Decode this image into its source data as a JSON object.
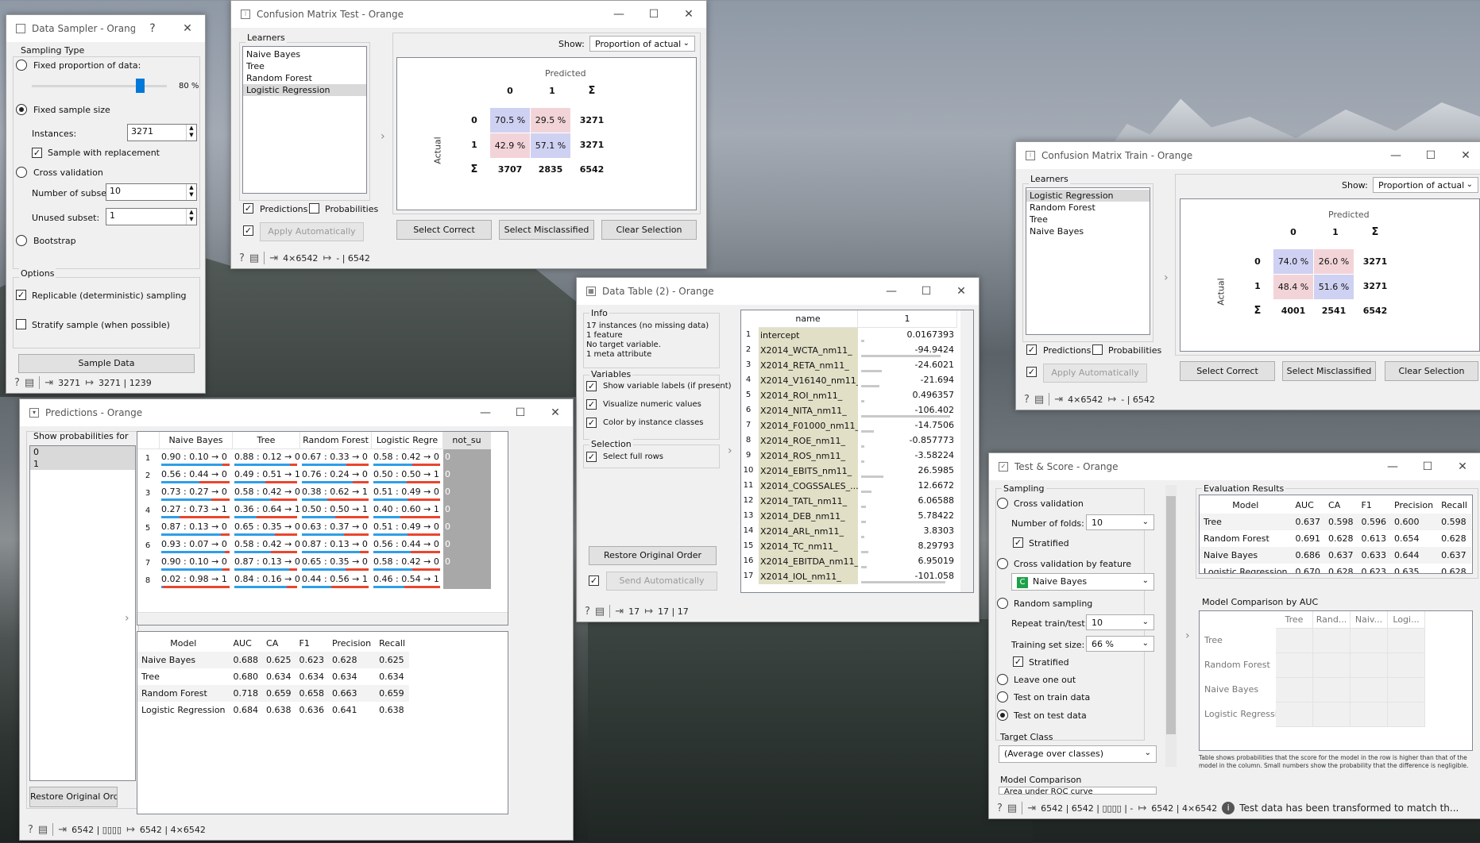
{
  "data_sampler": {
    "title": "Data Sampler - Orange",
    "help": "?",
    "sampling_type": "Sampling Type",
    "fixed_proportion": "Fixed proportion of data:",
    "percent": "80 %",
    "fixed_size": "Fixed sample size",
    "instances_label": "Instances:",
    "instances": "3271",
    "replacement": "Sample with replacement",
    "cross_validation": "Cross validation",
    "subsets_label": "Number of subsets:",
    "subsets": "10",
    "unused_label": "Unused subset:",
    "unused": "1",
    "bootstrap": "Bootstrap",
    "options": "Options",
    "replicable": "Replicable (deterministic) sampling",
    "stratify": "Stratify sample (when possible)",
    "sample_btn": "Sample Data",
    "in": "3271",
    "out": "3271 | 1239",
    "slider_value": 0.8
  },
  "cm_test": {
    "title": "Confusion Matrix Test - Orange",
    "learners_label": "Learners",
    "learners": [
      "Naive Bayes",
      "Tree",
      "Random Forest",
      "Logistic Regression"
    ],
    "show": "Show:",
    "show_value": "Proportion of actual",
    "predicted": "Predicted",
    "actual": "Actual",
    "c0": "0",
    "c1": "1",
    "sum": "Σ",
    "r0c0": "70.5 %",
    "r0c1": "29.5 %",
    "r0s": "3271",
    "r1c0": "42.9 %",
    "r1c1": "57.1 %",
    "r1s": "3271",
    "s0": "3707",
    "s1": "2835",
    "st": "6542",
    "predictions": "Predictions",
    "probabilities": "Probabilities",
    "apply": "Apply Automatically",
    "sel_correct": "Select Correct",
    "sel_mis": "Select Misclassified",
    "clear": "Clear Selection",
    "in": "4×6542",
    "out": "- | 6542"
  },
  "cm_train": {
    "title": "Confusion Matrix Train - Orange",
    "learners_label": "Learners",
    "learners": [
      "Logistic Regression",
      "Random Forest",
      "Tree",
      "Naive Bayes"
    ],
    "show": "Show:",
    "show_value": "Proportion of actual",
    "predicted": "Predicted",
    "actual": "Actual",
    "c0": "0",
    "c1": "1",
    "sum": "Σ",
    "r0c0": "74.0 %",
    "r0c1": "26.0 %",
    "r0s": "3271",
    "r1c0": "48.4 %",
    "r1c1": "51.6 %",
    "r1s": "3271",
    "s0": "4001",
    "s1": "2541",
    "st": "6542",
    "predictions": "Predictions",
    "probabilities": "Probabilities",
    "apply": "Apply Automatically",
    "sel_correct": "Select Correct",
    "sel_mis": "Select Misclassified",
    "clear": "Clear Selection",
    "in": "4×6542",
    "out": "- | 6542"
  },
  "data_table": {
    "title": "Data Table (2) - Orange",
    "info": "Info",
    "info_lines": [
      "17 instances (no missing data)",
      "1 feature",
      "No target variable.",
      "1 meta attribute"
    ],
    "variables": "Variables",
    "show_labels": "Show variable labels (if present)",
    "visualize": "Visualize numeric values",
    "color": "Color by instance classes",
    "selection": "Selection",
    "select_full": "Select full rows",
    "restore": "Restore Original Order",
    "send": "Send Automatically",
    "col_name": "name",
    "col_val": "1",
    "rows": [
      {
        "n": "1",
        "name": "intercept",
        "v": "0.0167393"
      },
      {
        "n": "2",
        "name": "X2014_WCTA_nm11_",
        "v": "-94.9424"
      },
      {
        "n": "3",
        "name": "X2014_RETA_nm11_",
        "v": "-24.6021"
      },
      {
        "n": "4",
        "name": "X2014_V16140_nm11_",
        "v": "-21.694"
      },
      {
        "n": "5",
        "name": "X2014_ROI_nm11_",
        "v": "0.496357"
      },
      {
        "n": "6",
        "name": "X2014_NITA_nm11_",
        "v": "-106.402"
      },
      {
        "n": "7",
        "name": "X2014_F01000_nm11_",
        "v": "-14.7506"
      },
      {
        "n": "8",
        "name": "X2014_ROE_nm11_",
        "v": "-0.857773"
      },
      {
        "n": "9",
        "name": "X2014_ROS_nm11_",
        "v": "-3.58224"
      },
      {
        "n": "10",
        "name": "X2014_EBITS_nm11_",
        "v": "26.5985"
      },
      {
        "n": "11",
        "name": "X2014_COGSSALES_...",
        "v": "12.6672"
      },
      {
        "n": "12",
        "name": "X2014_TATL_nm11_",
        "v": "6.06588"
      },
      {
        "n": "13",
        "name": "X2014_DEB_nm11_",
        "v": "5.78422"
      },
      {
        "n": "14",
        "name": "X2014_ARL_nm11_",
        "v": "3.8303"
      },
      {
        "n": "15",
        "name": "X2014_TC_nm11_",
        "v": "8.29793"
      },
      {
        "n": "16",
        "name": "X2014_EBITDA_nm11_",
        "v": "6.95019"
      },
      {
        "n": "17",
        "name": "X2014_IOL_nm11_",
        "v": "-101.058"
      }
    ],
    "in": "17",
    "out": "17 | 17"
  },
  "predictions": {
    "title": "Predictions - Orange",
    "show_prob": "Show probabilities for",
    "classes": [
      "0",
      "1"
    ],
    "restore": "Restore Original Order",
    "cols": [
      "Naive Bayes",
      "Tree",
      "Random Forest",
      "Logistic Regre",
      "not_su"
    ],
    "rows": [
      [
        "0.90 : 0.10 → 0",
        "0.88 : 0.12 → 0",
        "0.67 : 0.33 → 0",
        "0.58 : 0.42 → 0",
        "0"
      ],
      [
        "0.56 : 0.44 → 0",
        "0.49 : 0.51 → 1",
        "0.76 : 0.24 → 0",
        "0.50 : 0.50 → 1",
        "0"
      ],
      [
        "0.73 : 0.27 → 0",
        "0.58 : 0.42 → 0",
        "0.38 : 0.62 → 1",
        "0.51 : 0.49 → 0",
        "0"
      ],
      [
        "0.27 : 0.73 → 1",
        "0.36 : 0.64 → 1",
        "0.50 : 0.50 → 1",
        "0.40 : 0.60 → 1",
        "0"
      ],
      [
        "0.87 : 0.13 → 0",
        "0.65 : 0.35 → 0",
        "0.63 : 0.37 → 0",
        "0.51 : 0.49 → 0",
        "0"
      ],
      [
        "0.93 : 0.07 → 0",
        "0.58 : 0.42 → 0",
        "0.87 : 0.13 → 0",
        "0.56 : 0.44 → 0",
        "0"
      ],
      [
        "0.90 : 0.10 → 0",
        "0.87 : 0.13 → 0",
        "0.65 : 0.35 → 0",
        "0.58 : 0.42 → 0",
        "0"
      ],
      [
        "0.02 : 0.98 → 1",
        "0.84 : 0.16 → 0",
        "0.44 : 0.56 → 1",
        "0.46 : 0.54 → 1",
        ""
      ]
    ],
    "score_head": [
      "Model",
      "AUC",
      "CA",
      "F1",
      "Precision",
      "Recall"
    ],
    "score_rows": [
      [
        "Naive Bayes",
        "0.688",
        "0.625",
        "0.623",
        "0.628",
        "0.625"
      ],
      [
        "Tree",
        "0.680",
        "0.634",
        "0.634",
        "0.634",
        "0.634"
      ],
      [
        "Random Forest",
        "0.718",
        "0.659",
        "0.658",
        "0.663",
        "0.659"
      ],
      [
        "Logistic Regression",
        "0.684",
        "0.638",
        "0.636",
        "0.641",
        "0.638"
      ]
    ],
    "in": "6542 | ▯▯▯▯",
    "out": "6542 | 4×6542"
  },
  "test_score": {
    "title": "Test & Score - Orange",
    "sampling": "Sampling",
    "cv": "Cross validation",
    "folds_label": "Number of folds:",
    "folds": "10",
    "stratified": "Stratified",
    "cv_feature": "Cross validation by feature",
    "feature": "Naive Bayes",
    "feature_icon": "C",
    "random": "Random sampling",
    "repeat_label": "Repeat train/test:",
    "repeat": "10",
    "train_size_label": "Training set size:",
    "train_size": "66 %",
    "stratified2": "Stratified",
    "loo": "Leave one out",
    "train_data": "Test on train data",
    "test_data": "Test on test data",
    "target": "Target Class",
    "target_value": "(Average over classes)",
    "model_comp": "Model Comparison",
    "model_comp_value": "Area under ROC curve",
    "eval": "Evaluation Results",
    "head": [
      "Model",
      "AUC",
      "CA",
      "F1",
      "Precision",
      "Recall"
    ],
    "rows": [
      [
        "Tree",
        "0.637",
        "0.598",
        "0.596",
        "0.600",
        "0.598"
      ],
      [
        "Random Forest",
        "0.691",
        "0.628",
        "0.613",
        "0.654",
        "0.628"
      ],
      [
        "Naive Bayes",
        "0.686",
        "0.637",
        "0.633",
        "0.644",
        "0.637"
      ],
      [
        "Logistic Regression",
        "0.670",
        "0.628",
        "0.623",
        "0.635",
        "0.628"
      ]
    ],
    "comp_title": "Model Comparison by AUC",
    "comp_cols": [
      "Tree",
      "Rand...",
      "Naiv...",
      "Logi..."
    ],
    "comp_rows": [
      "Tree",
      "Random Forest",
      "Naive Bayes",
      "Logistic Regression"
    ],
    "note": "Table shows probabilities that the score for the model in the row is higher than that of the model in the column. Small numbers show the probability that the difference is negligible.",
    "in": "6542 | 6542 | ▯▯▯▯ | -",
    "out": "6542 | 4×6542",
    "msg": "Test data has been transformed to match th..."
  }
}
